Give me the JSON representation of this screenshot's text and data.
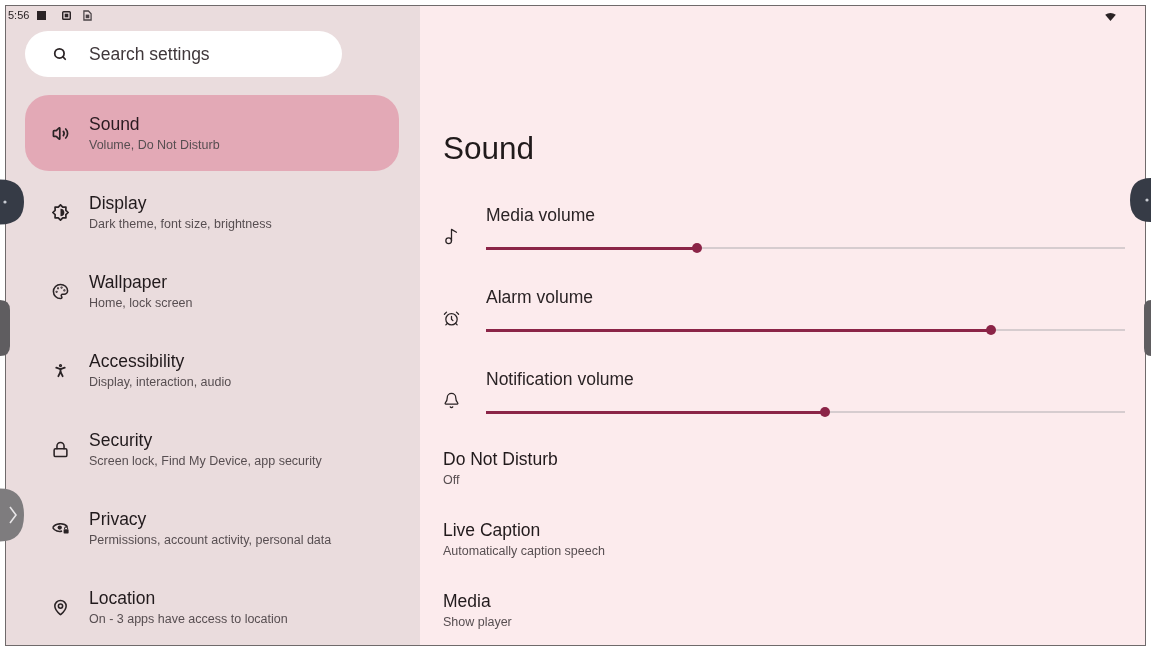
{
  "status_bar": {
    "time": "5:56"
  },
  "search": {
    "placeholder": "Search settings"
  },
  "sidebar": {
    "items": [
      {
        "title": "Sound",
        "subtitle": "Volume, Do Not Disturb",
        "selected": true
      },
      {
        "title": "Display",
        "subtitle": "Dark theme, font size, brightness",
        "selected": false
      },
      {
        "title": "Wallpaper",
        "subtitle": "Home, lock screen",
        "selected": false
      },
      {
        "title": "Accessibility",
        "subtitle": "Display, interaction, audio",
        "selected": false
      },
      {
        "title": "Security",
        "subtitle": "Screen lock, Find My Device, app security",
        "selected": false
      },
      {
        "title": "Privacy",
        "subtitle": "Permissions, account activity, personal data",
        "selected": false
      },
      {
        "title": "Location",
        "subtitle": "On - 3 apps have access to location",
        "selected": false
      }
    ]
  },
  "page": {
    "title": "Sound",
    "sliders": [
      {
        "label": "Media volume",
        "level": 0.33
      },
      {
        "label": "Alarm volume",
        "level": 0.79
      },
      {
        "label": "Notification volume",
        "level": 0.53
      }
    ],
    "items": [
      {
        "title": "Do Not Disturb",
        "subtitle": "Off"
      },
      {
        "title": "Live Caption",
        "subtitle": "Automatically caption speech"
      },
      {
        "title": "Media",
        "subtitle": "Show player"
      }
    ]
  }
}
